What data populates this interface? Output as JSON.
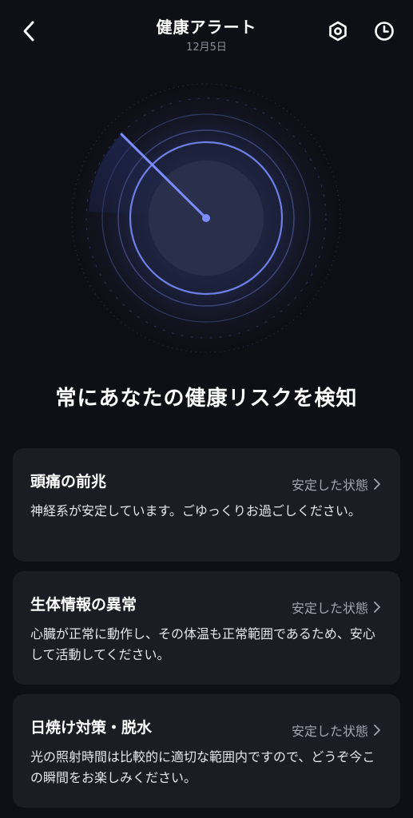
{
  "header": {
    "title": "健康アラート",
    "date": "12月5日"
  },
  "headline": "常にあなたの健康リスクを検知",
  "cards": [
    {
      "title": "頭痛の前兆",
      "status": "安定した状態",
      "description": "神経系が安定しています。ごゆっくりお過ごしください。"
    },
    {
      "title": "生体情報の異常",
      "status": "安定した状態",
      "description": "心臓が正常に動作し、その体温も正常範囲であるため、安心して活動してください。"
    },
    {
      "title": "日焼け対策・脱水",
      "status": "安定した状態",
      "description": "光の照射時間は比較的に適切な範囲内ですので、どうぞ今この瞬間をお楽しみください。"
    }
  ],
  "colors": {
    "background": "#0f0f16",
    "card": "#1c1c24",
    "accent": "#7b8cff",
    "muted": "#a3a5b1"
  },
  "icons": {
    "back": "chevron-left-icon",
    "settings": "hexagon-gear-icon",
    "history": "clock-icon",
    "status_arrow": "chevron-right-icon"
  }
}
